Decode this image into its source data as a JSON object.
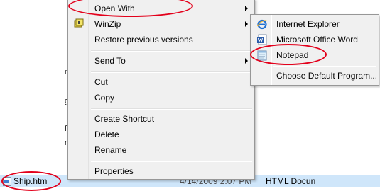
{
  "background": {
    "fragments": [
      "n",
      "g",
      "f",
      "r"
    ],
    "file_row": {
      "name": "Ship.htm",
      "date": "4/14/2009 2:07 PM",
      "type": "HTML Docun"
    }
  },
  "context_menu": {
    "items": [
      {
        "label": "Open With",
        "has_submenu": true
      },
      {
        "label": "WinZip",
        "has_submenu": true,
        "icon": "winzip-icon"
      },
      {
        "label": "Restore previous versions"
      },
      {
        "label": "Send To",
        "has_submenu": true
      },
      {
        "label": "Cut"
      },
      {
        "label": "Copy"
      },
      {
        "label": "Create Shortcut"
      },
      {
        "label": "Delete"
      },
      {
        "label": "Rename"
      },
      {
        "label": "Properties"
      }
    ]
  },
  "submenu": {
    "items": [
      {
        "label": "Internet Explorer",
        "icon": "internet-explorer-icon"
      },
      {
        "label": "Microsoft Office Word",
        "icon": "word-icon"
      },
      {
        "label": "Notepad",
        "icon": "notepad-icon"
      },
      {
        "label": "Choose Default Program..."
      }
    ]
  },
  "colors": {
    "annotation": "#e3001b",
    "menu_background": "#f0f0f0",
    "selected_row": "#cfe6fa"
  }
}
